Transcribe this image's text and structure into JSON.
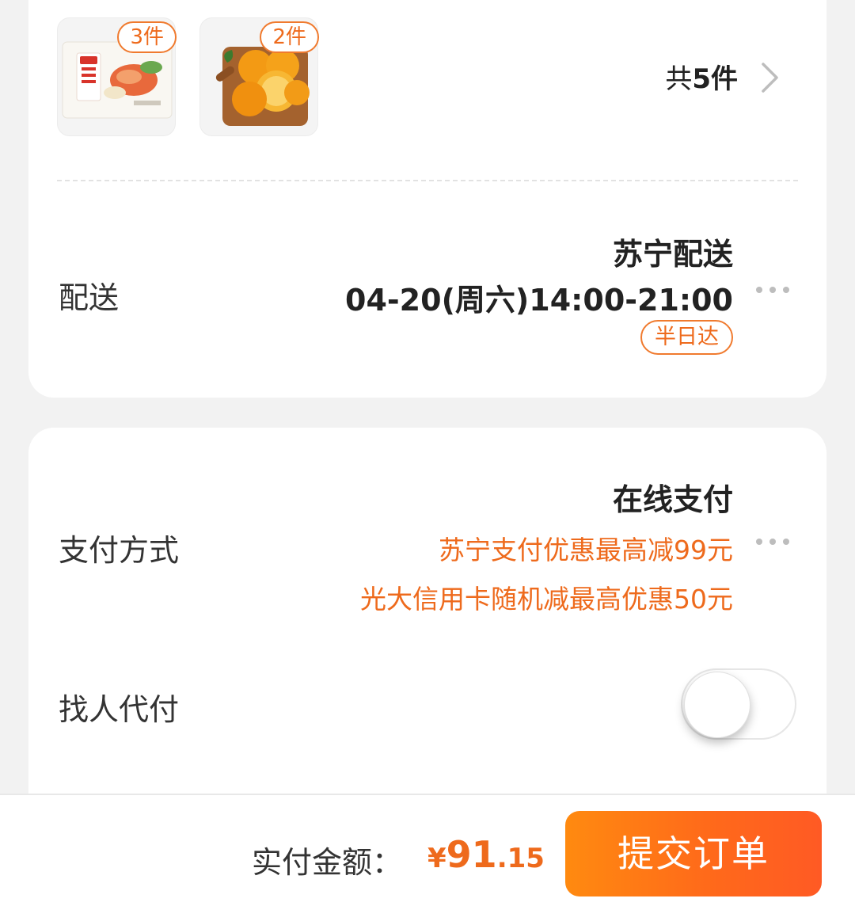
{
  "order_items": {
    "products": [
      {
        "name": "shrimp-dumplings-product",
        "qty_badge": "3件"
      },
      {
        "name": "oranges-product",
        "qty_badge": "2件"
      }
    ],
    "total_prefix": "共",
    "total_value": "5件"
  },
  "delivery": {
    "label": "配送",
    "provider": "苏宁配送",
    "time_window": "04-20(周六)14:00-21:00",
    "speed_tag": "半日达"
  },
  "payment": {
    "label": "支付方式",
    "method": "在线支付",
    "promo_1": "苏宁支付优惠最高减99元",
    "promo_2": "光大信用卡随机减最高优惠50元"
  },
  "pay_for_me": {
    "label": "找人代付",
    "enabled": false
  },
  "footer": {
    "amount_label": "实付金额：",
    "currency": "¥",
    "amount_int": "91",
    "amount_dec": ".15",
    "submit_label": "提交订单"
  },
  "colors": {
    "accent": "#ee6a1c",
    "button_start": "#ff8a10",
    "button_end": "#ff5a24",
    "background": "#f2f2f2"
  }
}
